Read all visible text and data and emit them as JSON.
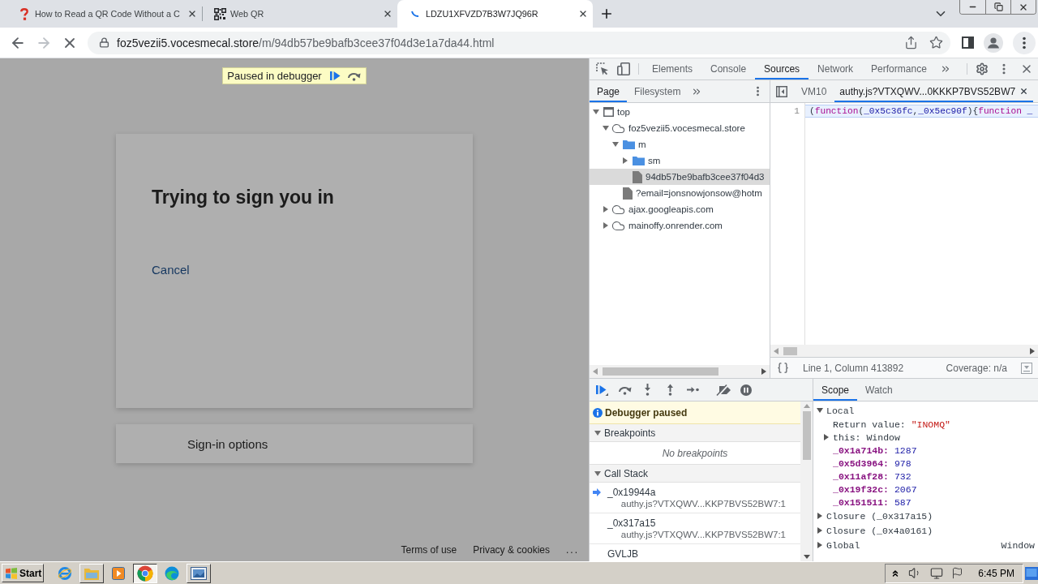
{
  "browser": {
    "tabs": [
      {
        "title": "How to Read a QR Code Without a C",
        "kind": "question",
        "selected": false
      },
      {
        "title": "Web QR",
        "kind": "qr",
        "selected": false
      },
      {
        "title": "LDZU1XFVZD7B3W7JQ96R",
        "kind": "loading",
        "selected": true
      }
    ],
    "can_go_forward": false,
    "loading": true,
    "address": {
      "host": "foz5vezii5.vocesmecal.store",
      "path": "/m/94db57be9bafb3cee37f04d3e1a7da44.html"
    }
  },
  "page": {
    "badge": "Paused in debugger",
    "title": "Trying to sign you in",
    "cancel": "Cancel",
    "options": "Sign-in options",
    "footer": [
      "Terms of use",
      "Privacy & cookies",
      "..."
    ]
  },
  "devtools": {
    "tabs": [
      {
        "label": "Elements",
        "selected": false
      },
      {
        "label": "Console",
        "selected": false
      },
      {
        "label": "Sources",
        "selected": true
      },
      {
        "label": "Network",
        "selected": false
      },
      {
        "label": "Performance",
        "selected": false
      }
    ],
    "navigator": {
      "tabs": [
        {
          "label": "Page",
          "selected": true
        },
        {
          "label": "Filesystem",
          "selected": false
        }
      ],
      "tree": [
        {
          "label": "top",
          "kind": "frame",
          "expanded": true,
          "selected": false,
          "children": [
            {
              "label": "foz5vezii5.vocesmecal.store",
              "kind": "domain",
              "expanded": true,
              "selected": false,
              "children": [
                {
                  "label": "m",
                  "kind": "folder",
                  "expanded": true,
                  "selected": false,
                  "children": [
                    {
                      "label": "sm",
                      "kind": "folder",
                      "expanded": false,
                      "selected": false
                    },
                    {
                      "label": "94db57be9bafb3cee37f04d3",
                      "kind": "file",
                      "selected": true
                    }
                  ]
                },
                {
                  "label": "?email=jonsnowjonsow@hotm",
                  "kind": "file",
                  "selected": false
                }
              ]
            },
            {
              "label": "ajax.googleapis.com",
              "kind": "domain",
              "expanded": false,
              "selected": false
            },
            {
              "label": "mainoffy.onrender.com",
              "kind": "domain",
              "expanded": false,
              "selected": false
            }
          ]
        }
      ]
    },
    "editor": {
      "tabs": [
        {
          "label": "VM10",
          "selected": false
        },
        {
          "label": "authy.js?VTXQWV...0KKKP7BVS52BW7",
          "selected": true
        }
      ],
      "lines": [
        {
          "number": "1",
          "tokens": [
            {
              "text": "(",
              "kind": "punct"
            },
            {
              "text": "function",
              "kind": "keyword"
            },
            {
              "text": "(",
              "kind": "punct"
            },
            {
              "text": "_0x5c36fc",
              "kind": "name"
            },
            {
              "text": ",",
              "kind": "punct"
            },
            {
              "text": "_0x5ec90f",
              "kind": "name"
            },
            {
              "text": "){",
              "kind": "punct"
            },
            {
              "text": "function",
              "kind": "keyword"
            },
            {
              "text": " _",
              "kind": "name"
            }
          ]
        }
      ],
      "position": "Line 1, Column 413892",
      "coverage": "Coverage: n/a"
    },
    "debugger": {
      "message": "Debugger paused",
      "breakpoints": {
        "title": "Breakpoints",
        "expanded": true,
        "empty": "No breakpoints"
      },
      "call_stack": {
        "title": "Call Stack",
        "expanded": true,
        "frames": [
          {
            "name": "_0x19944a",
            "location": "authy.js?VTXQWV...KKP7BVS52BW7:1",
            "selected": true
          },
          {
            "name": "_0x317a15",
            "location": "authy.js?VTXQWV...KKP7BVS52BW7:1",
            "selected": false
          },
          {
            "name": "GVLJB",
            "selected": false
          }
        ]
      }
    },
    "scope": {
      "tabs": [
        {
          "label": "Scope",
          "selected": true
        },
        {
          "label": "Watch",
          "selected": false
        }
      ],
      "tree": [
        {
          "name": "Local",
          "expanded": true,
          "children": [
            {
              "name": "Return value:",
              "value": "\"INOMQ\"",
              "kind": "string"
            },
            {
              "name": "this:",
              "value": "Window",
              "kind": "object",
              "expanded": false
            },
            {
              "name": "_0x1a714b:",
              "value": "1287",
              "kind": "number"
            },
            {
              "name": "_0x5d3964:",
              "value": "978",
              "kind": "number"
            },
            {
              "name": "_0x11af28:",
              "value": "732",
              "kind": "number"
            },
            {
              "name": "_0x19f32c:",
              "value": "2067",
              "kind": "number"
            },
            {
              "name": "_0x151511:",
              "value": "587",
              "kind": "number"
            }
          ]
        },
        {
          "name": "Closure (_0x317a15)",
          "expanded": false
        },
        {
          "name": "Closure (_0x4a0161)",
          "expanded": false
        },
        {
          "name": "Global",
          "value": "Window",
          "expanded": false
        }
      ]
    }
  },
  "taskbar": {
    "start": "Start",
    "apps": [
      {
        "kind": "ie",
        "running": false,
        "selected": false
      },
      {
        "kind": "folder",
        "running": true,
        "selected": false
      },
      {
        "kind": "media",
        "running": false,
        "selected": false
      },
      {
        "kind": "chrome",
        "running": true,
        "selected": true
      },
      {
        "kind": "edge",
        "running": false,
        "selected": false
      },
      {
        "kind": "screen",
        "running": true,
        "selected": false
      }
    ],
    "clock": "6:45 PM"
  }
}
